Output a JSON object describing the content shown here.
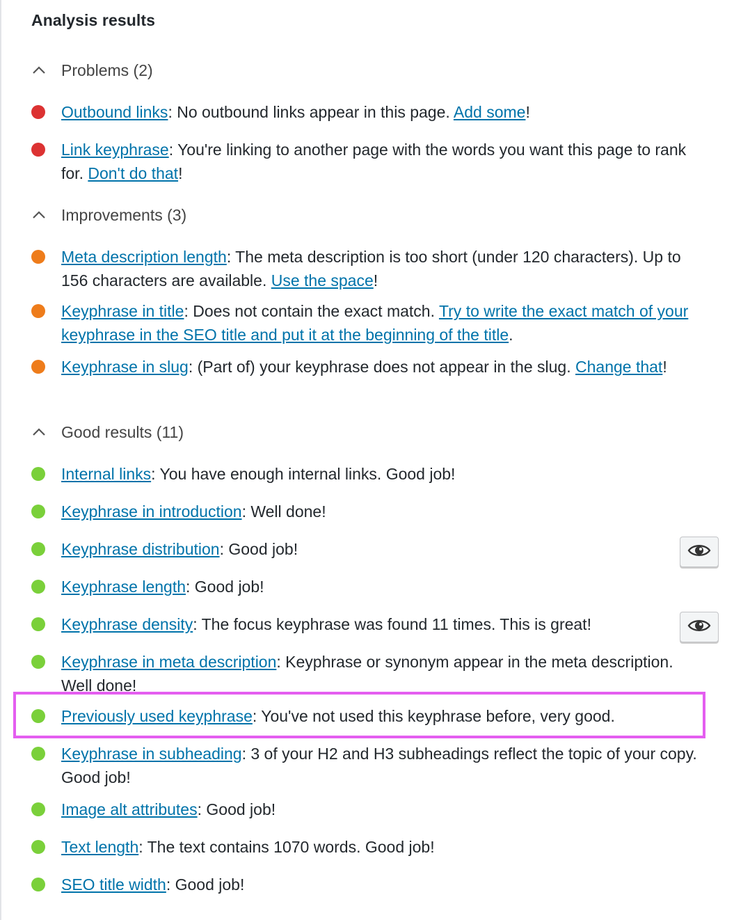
{
  "panel": {
    "title": "Analysis results"
  },
  "colors": {
    "problem": "#dc3232",
    "improvement": "#ee7c1b",
    "good": "#7ad03a",
    "link": "#0073aa",
    "highlight": "#e45ef0"
  },
  "problems": {
    "header": "Problems (2)",
    "items": [
      {
        "link": "Outbound links",
        "text": ": No outbound links appear in this page. ",
        "link2": "Add some",
        "end": "!"
      },
      {
        "link": "Link keyphrase",
        "text": ": You're linking to another page with the words you want this page to rank for. ",
        "link2": "Don't do that",
        "end": "!"
      }
    ]
  },
  "improvements": {
    "header": "Improvements (3)",
    "items": [
      {
        "link": "Meta description length",
        "text": ": The meta description is too short (under 120 characters). Up to 156 characters are available. ",
        "link2": "Use the space",
        "end": "!"
      },
      {
        "link": "Keyphrase in title",
        "text": ": Does not contain the exact match. ",
        "link2": "Try to write the exact match of your keyphrase in the SEO title and put it at the beginning of the title",
        "end": "."
      },
      {
        "link": "Keyphrase in slug",
        "text": ": (Part of) your keyphrase does not appear in the slug. ",
        "link2": "Change that",
        "end": "!"
      }
    ]
  },
  "good": {
    "header": "Good results (11)",
    "items": [
      {
        "link": "Internal links",
        "text": ": You have enough internal links. Good job!"
      },
      {
        "link": "Keyphrase in introduction",
        "text": ": Well done!"
      },
      {
        "link": "Keyphrase distribution",
        "text": ": Good job!"
      },
      {
        "link": "Keyphrase length",
        "text": ": Good job!"
      },
      {
        "link": "Keyphrase density",
        "text": ": The focus keyphrase was found 11 times. This is great!"
      },
      {
        "link": "Keyphrase in meta description",
        "text": ": Keyphrase or synonym appear in the meta description. Well done!"
      },
      {
        "link": "Previously used keyphrase",
        "text": ": You've not used this keyphrase before, very good."
      },
      {
        "link": "Keyphrase in subheading",
        "text": ": 3 of your H2 and H3 subheadings reflect the topic of your copy. Good job!"
      },
      {
        "link": "Image alt attributes",
        "text": ": Good job!"
      },
      {
        "link": "Text length",
        "text": ": The text contains 1070 words. Good job!"
      },
      {
        "link": "SEO title width",
        "text": ": Good job!"
      }
    ]
  },
  "icons": {
    "chevron": "chevron-up-icon",
    "eye": "eye-icon"
  }
}
